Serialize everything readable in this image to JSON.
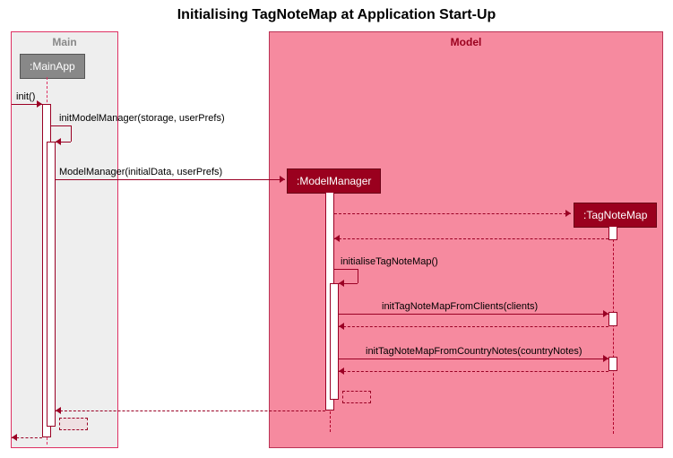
{
  "title": "Initialising TagNoteMap at Application Start-Up",
  "frames": {
    "main": {
      "label": "Main",
      "bg": "#eeeeee",
      "border": "#de3163",
      "labelColor": "#888"
    },
    "model": {
      "label": "Model",
      "bg": "#f68a9f",
      "border": "#bb3355",
      "labelColor": "#9a001e"
    }
  },
  "objects": {
    "mainApp": {
      "label": ":MainApp",
      "bg": "#888888",
      "border": "#555"
    },
    "modelManager": {
      "label": ":ModelManager",
      "bg": "#9a001e",
      "border": "#6a0015"
    },
    "tagNoteMap": {
      "label": ":TagNoteMap",
      "bg": "#9a001e",
      "border": "#6a0015"
    }
  },
  "messages": {
    "init": "init()",
    "initModelManager": "initModelManager(storage, userPrefs)",
    "modelManagerCtor": "ModelManager(initialData, userPrefs)",
    "initialiseTagNoteMap": "initialiseTagNoteMap()",
    "fromClients": "initTagNoteMapFromClients(clients)",
    "fromCountryNotes": "initTagNoteMapFromCountryNotes(countryNotes)"
  },
  "chart_data": {
    "type": "sequence-diagram",
    "title": "Initialising TagNoteMap at Application Start-Up",
    "participants": [
      {
        "name": ":MainApp",
        "frame": "Main"
      },
      {
        "name": ":ModelManager",
        "frame": "Model",
        "created_by": ":MainApp"
      },
      {
        "name": ":TagNoteMap",
        "frame": "Model",
        "created_by": ":ModelManager"
      }
    ],
    "frames": [
      "Main",
      "Model"
    ],
    "messages": [
      {
        "from": "caller",
        "to": ":MainApp",
        "label": "init()",
        "type": "call"
      },
      {
        "from": ":MainApp",
        "to": ":MainApp",
        "label": "initModelManager(storage, userPrefs)",
        "type": "self-call"
      },
      {
        "from": ":MainApp",
        "to": ":ModelManager",
        "label": "ModelManager(initialData, userPrefs)",
        "type": "create"
      },
      {
        "from": ":ModelManager",
        "to": ":TagNoteMap",
        "label": "",
        "type": "create"
      },
      {
        "from": ":TagNoteMap",
        "to": ":ModelManager",
        "label": "",
        "type": "return"
      },
      {
        "from": ":ModelManager",
        "to": ":ModelManager",
        "label": "initialiseTagNoteMap()",
        "type": "self-call"
      },
      {
        "from": ":ModelManager",
        "to": ":TagNoteMap",
        "label": "initTagNoteMapFromClients(clients)",
        "type": "call"
      },
      {
        "from": ":TagNoteMap",
        "to": ":ModelManager",
        "label": "",
        "type": "return"
      },
      {
        "from": ":ModelManager",
        "to": ":TagNoteMap",
        "label": "initTagNoteMapFromCountryNotes(countryNotes)",
        "type": "call"
      },
      {
        "from": ":TagNoteMap",
        "to": ":ModelManager",
        "label": "",
        "type": "return"
      },
      {
        "from": ":ModelManager",
        "to": ":MainApp",
        "label": "",
        "type": "return"
      },
      {
        "from": ":MainApp",
        "to": ":MainApp",
        "label": "",
        "type": "self-return"
      },
      {
        "from": ":MainApp",
        "to": "caller",
        "label": "",
        "type": "return"
      }
    ]
  }
}
